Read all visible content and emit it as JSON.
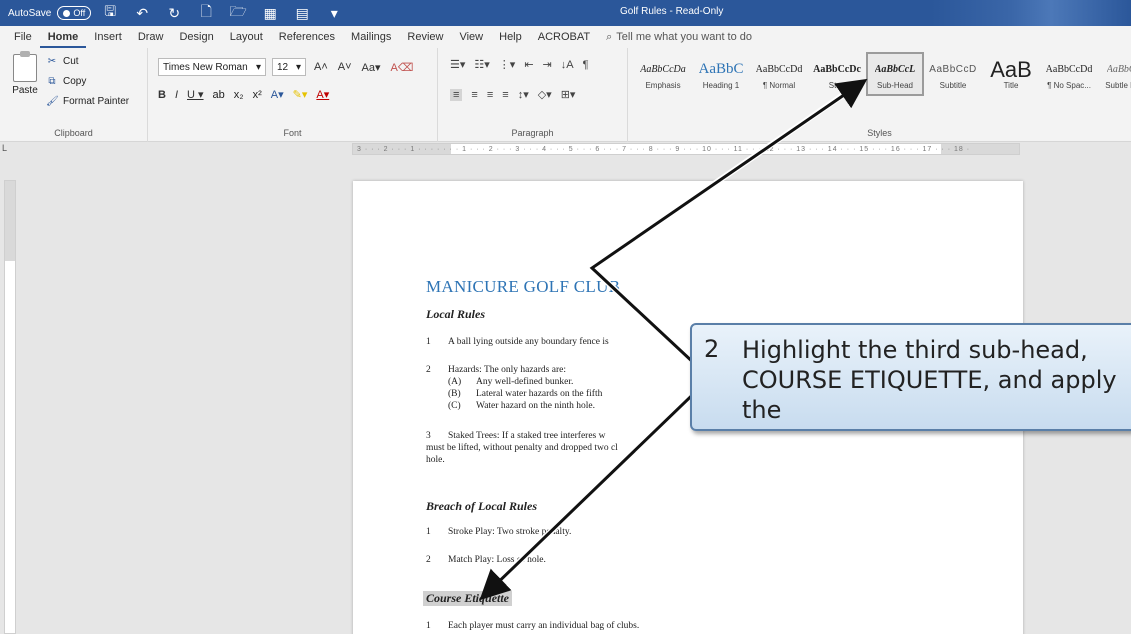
{
  "titlebar": {
    "autosave_label": "AutoSave",
    "autosave_state": "Off",
    "doc_title": "Golf Rules - Read-Only"
  },
  "menu": {
    "tabs": [
      "File",
      "Home",
      "Insert",
      "Draw",
      "Design",
      "Layout",
      "References",
      "Mailings",
      "Review",
      "View",
      "Help",
      "ACROBAT"
    ],
    "tellme": "Tell me what you want to do"
  },
  "ribbon": {
    "clipboard": {
      "paste": "Paste",
      "cut": "Cut",
      "copy": "Copy",
      "format_painter": "Format Painter",
      "label": "Clipboard"
    },
    "font": {
      "name": "Times New Roman",
      "size": "12",
      "label": "Font"
    },
    "paragraph": {
      "label": "Paragraph"
    },
    "styles": {
      "label": "Styles",
      "items": [
        {
          "preview": "AaBbCcDa",
          "name": "Emphasis"
        },
        {
          "preview": "AaBbC",
          "name": "Heading 1"
        },
        {
          "preview": "AaBbCcDd",
          "name": "¶ Normal"
        },
        {
          "preview": "AaBbCcDc",
          "name": "Str..."
        },
        {
          "preview": "AaBbCcL",
          "name": "Sub-Head"
        },
        {
          "preview": "AaBbCcD",
          "name": "Subtitle"
        },
        {
          "preview": "AaB",
          "name": "Title"
        },
        {
          "preview": "AaBbCcDd",
          "name": "¶ No Spac..."
        },
        {
          "preview": "AaBbCcD",
          "name": "Subtle Em..."
        }
      ],
      "selected_index": 4
    }
  },
  "ruler": {
    "text": "3 · · · 2 · · · 1 · · · · · · · 1 · · · 2 · · · 3 · · · 4 · · · 5 · · · 6 · · · 7 · · · 8 · · · 9 · · · 10 · · · 11 · · · 12 · · · 13 · · · 14 · · · 15 · · · 16 · · · 17 · · · 18 ·"
  },
  "document": {
    "heading": "MANICURE GOLF CLUB",
    "local_rules": "Local Rules",
    "lr1_num": "1",
    "lr1_text": "A ball lying outside any boundary fence is",
    "lr2_num": "2",
    "lr2_text": "Hazards:  The only hazards are:",
    "lr2a_num": "(A)",
    "lr2a_text": "Any well-defined bunker.",
    "lr2b_num": "(B)",
    "lr2b_text": "Lateral water hazards on the fifth",
    "lr2c_num": "(C)",
    "lr2c_text": "Water hazard on the ninth hole.",
    "lr3_num": "3",
    "lr3_text": "Staked Trees:  If a staked tree interferes w",
    "lr3_line2": "must be lifted, without penalty and dropped two cl",
    "lr3_line3": "hole.",
    "breach": "Breach of Local Rules",
    "b1_num": "1",
    "b1_text": "Stroke Play:  Two stroke penalty.",
    "b2_num": "2",
    "b2_text": "Match Play:  Loss of hole.",
    "etiquette": "Course Etiquette",
    "e1_num": "1",
    "e1_text": "Each player must carry an individual bag of clubs."
  },
  "callout": {
    "number": "2",
    "text": "Highlight the third sub-head,\nCOURSE ETIQUETTE, and apply the\nSUB-HEAD style to it."
  }
}
